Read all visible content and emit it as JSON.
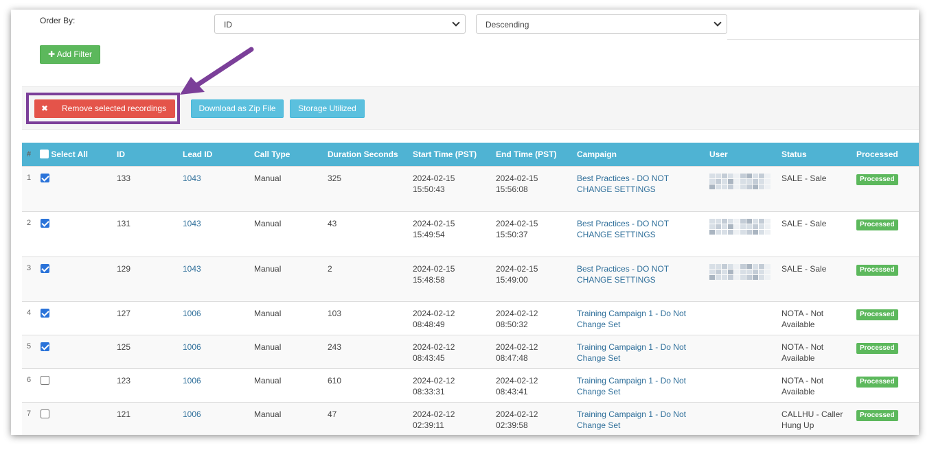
{
  "filters": {
    "order_by_label": "Order By:",
    "order_field": "ID",
    "order_direction": "Descending",
    "add_filter_label": "Add Filter"
  },
  "toolbar": {
    "remove_label": "Remove selected recordings",
    "zip_label": "Download as Zip File",
    "storage_label": "Storage Utilized"
  },
  "annotation": {
    "highlight_color": "#7b3f99"
  },
  "table": {
    "headers": {
      "num": "#",
      "select_all": "Select All",
      "id": "ID",
      "lead_id": "Lead ID",
      "call_type": "Call Type",
      "duration": "Duration Seconds",
      "start": "Start Time (PST)",
      "end": "End Time (PST)",
      "campaign": "Campaign",
      "user": "User",
      "status": "Status",
      "processed": "Processed"
    },
    "rows": [
      {
        "num": "1",
        "checked": true,
        "id": "133",
        "lead_id": "1043",
        "call_type": "Manual",
        "duration": "325",
        "start_date": "2024-02-15",
        "start_time": "15:50:43",
        "end_date": "2024-02-15",
        "end_time": "15:56:08",
        "campaign_1": "Best Practices - DO NOT",
        "campaign_2": "CHANGE SETTINGS",
        "status_1": "SALE - Sale",
        "status_2": "",
        "processed": "Processed",
        "user_redacted": true
      },
      {
        "num": "2",
        "checked": true,
        "id": "131",
        "lead_id": "1043",
        "call_type": "Manual",
        "duration": "43",
        "start_date": "2024-02-15",
        "start_time": "15:49:54",
        "end_date": "2024-02-15",
        "end_time": "15:50:37",
        "campaign_1": "Best Practices - DO NOT",
        "campaign_2": "CHANGE SETTINGS",
        "status_1": "SALE - Sale",
        "status_2": "",
        "processed": "Processed",
        "user_redacted": true
      },
      {
        "num": "3",
        "checked": true,
        "id": "129",
        "lead_id": "1043",
        "call_type": "Manual",
        "duration": "2",
        "start_date": "2024-02-15",
        "start_time": "15:48:58",
        "end_date": "2024-02-15",
        "end_time": "15:49:00",
        "campaign_1": "Best Practices - DO NOT",
        "campaign_2": "CHANGE SETTINGS",
        "status_1": "SALE - Sale",
        "status_2": "",
        "processed": "Processed",
        "user_redacted": true
      },
      {
        "num": "4",
        "checked": true,
        "id": "127",
        "lead_id": "1006",
        "call_type": "Manual",
        "duration": "103",
        "start_date": "2024-02-12",
        "start_time": "08:48:49",
        "end_date": "2024-02-12",
        "end_time": "08:50:32",
        "campaign_1": "Training Campaign 1 - Do Not",
        "campaign_2": "Change Set",
        "status_1": "NOTA - Not",
        "status_2": "Available",
        "processed": "Processed",
        "user_redacted": false
      },
      {
        "num": "5",
        "checked": true,
        "id": "125",
        "lead_id": "1006",
        "call_type": "Manual",
        "duration": "243",
        "start_date": "2024-02-12",
        "start_time": "08:43:45",
        "end_date": "2024-02-12",
        "end_time": "08:47:48",
        "campaign_1": "Training Campaign 1 - Do Not",
        "campaign_2": "Change Set",
        "status_1": "NOTA - Not",
        "status_2": "Available",
        "processed": "Processed",
        "user_redacted": false
      },
      {
        "num": "6",
        "checked": false,
        "id": "123",
        "lead_id": "1006",
        "call_type": "Manual",
        "duration": "610",
        "start_date": "2024-02-12",
        "start_time": "08:33:31",
        "end_date": "2024-02-12",
        "end_time": "08:43:41",
        "campaign_1": "Training Campaign 1 - Do Not",
        "campaign_2": "Change Set",
        "status_1": "NOTA - Not",
        "status_2": "Available",
        "processed": "Processed",
        "user_redacted": false
      },
      {
        "num": "7",
        "checked": false,
        "id": "121",
        "lead_id": "1006",
        "call_type": "Manual",
        "duration": "47",
        "start_date": "2024-02-12",
        "start_time": "02:39:11",
        "end_date": "2024-02-12",
        "end_time": "02:39:58",
        "campaign_1": "Training Campaign 1 - Do Not",
        "campaign_2": "Change Set",
        "status_1": "CALLHU - Caller",
        "status_2": "Hung Up",
        "processed": "Processed",
        "user_redacted": false
      }
    ]
  }
}
